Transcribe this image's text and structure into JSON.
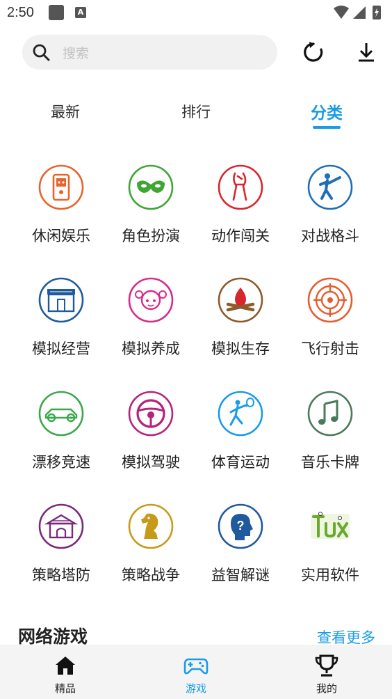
{
  "status_bar": {
    "time": "2:50"
  },
  "search": {
    "placeholder": "搜索"
  },
  "tabs": [
    {
      "label": "最新",
      "active": false
    },
    {
      "label": "排行",
      "active": false
    },
    {
      "label": "分类",
      "active": true
    }
  ],
  "categories": [
    {
      "label": "休闲娱乐",
      "icon": "game-console-icon",
      "color": "#e8642a"
    },
    {
      "label": "角色扮演",
      "icon": "mask-icon",
      "color": "#3fa535"
    },
    {
      "label": "动作闯关",
      "icon": "fighter-icon",
      "color": "#d8262e"
    },
    {
      "label": "对战格斗",
      "icon": "kick-icon",
      "color": "#1f6fb5"
    },
    {
      "label": "模拟经营",
      "icon": "shop-icon",
      "color": "#1f5a9e"
    },
    {
      "label": "模拟养成",
      "icon": "girl-icon",
      "color": "#d92b8a"
    },
    {
      "label": "模拟生存",
      "icon": "campfire-icon",
      "color": "#8c5a2b"
    },
    {
      "label": "飞行射击",
      "icon": "target-icon",
      "color": "#e55d2e"
    },
    {
      "label": "漂移竞速",
      "icon": "race-car-icon",
      "color": "#3aa84a"
    },
    {
      "label": "模拟驾驶",
      "icon": "steering-wheel-icon",
      "color": "#b5237a"
    },
    {
      "label": "体育运动",
      "icon": "tennis-player-icon",
      "color": "#1a9be6"
    },
    {
      "label": "音乐卡牌",
      "icon": "music-note-icon",
      "color": "#4a7a5a"
    },
    {
      "label": "策略塔防",
      "icon": "tower-icon",
      "color": "#7a2a7a"
    },
    {
      "label": "策略战争",
      "icon": "chess-knight-icon",
      "color": "#c79a1a"
    },
    {
      "label": "益智解谜",
      "icon": "puzzle-head-icon",
      "color": "#1f5a9e"
    },
    {
      "label": "实用软件",
      "icon": "tux-text-icon",
      "color": "#6aa830"
    }
  ],
  "section": {
    "title": "网络游戏",
    "more": "查看更多"
  },
  "bottom_nav": [
    {
      "label": "精品",
      "icon": "home-icon",
      "active": false
    },
    {
      "label": "游戏",
      "icon": "gamepad-icon",
      "active": true
    },
    {
      "label": "我的",
      "icon": "trophy-icon",
      "active": false
    }
  ],
  "colors": {
    "accent": "#1a9be6"
  }
}
